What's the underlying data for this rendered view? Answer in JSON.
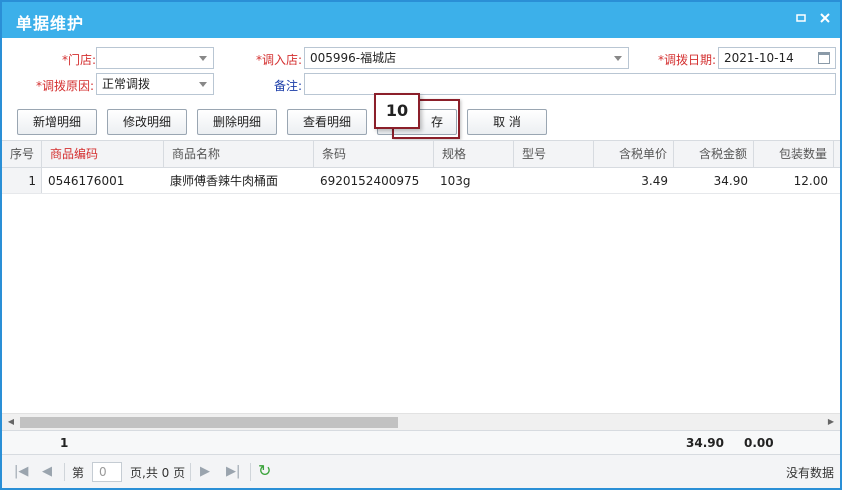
{
  "window": {
    "title": "单据维护",
    "minimize_icon": "minimize-icon",
    "close_icon": "close-icon"
  },
  "form": {
    "store_label": "*门店:",
    "store_value": "",
    "in_store_label": "*调入店:",
    "in_store_value": "005996-福城店",
    "transfer_date_label": "*调拨日期:",
    "transfer_date_value": "2021-10-14",
    "reason_label": "*调拨原因:",
    "reason_value": "正常调拨",
    "remark_label": "备注:",
    "remark_value": ""
  },
  "toolbar": {
    "add_detail": "新增明细",
    "edit_detail": "修改明细",
    "delete_detail": "删除明细",
    "view_detail": "查看明细",
    "save": "存",
    "cancel": "取 消"
  },
  "overlay_badge": "10",
  "grid": {
    "columns": [
      "序号",
      "商品编码",
      "商品名称",
      "条码",
      "规格",
      "型号",
      "含税单价",
      "含税金额",
      "包装数量"
    ],
    "rows": [
      {
        "no": "1",
        "code": "0546176001",
        "name": "康师傅香辣牛肉桶面",
        "barcode": "6920152400975",
        "spec": "103g",
        "model": "",
        "unit_price": "3.49",
        "amount": "34.90",
        "pack_qty": "12.00"
      }
    ],
    "footer": {
      "count": "1",
      "amount_total": "34.90",
      "pack_total": "0.00"
    }
  },
  "pager": {
    "page_label": "第",
    "page_value": "0",
    "page_total": "页,共 0 页",
    "status": "没有数据"
  },
  "colors": {
    "titlebar": "#3cb0ea",
    "required": "#d43030",
    "overlay_border": "#8b1f2a"
  }
}
